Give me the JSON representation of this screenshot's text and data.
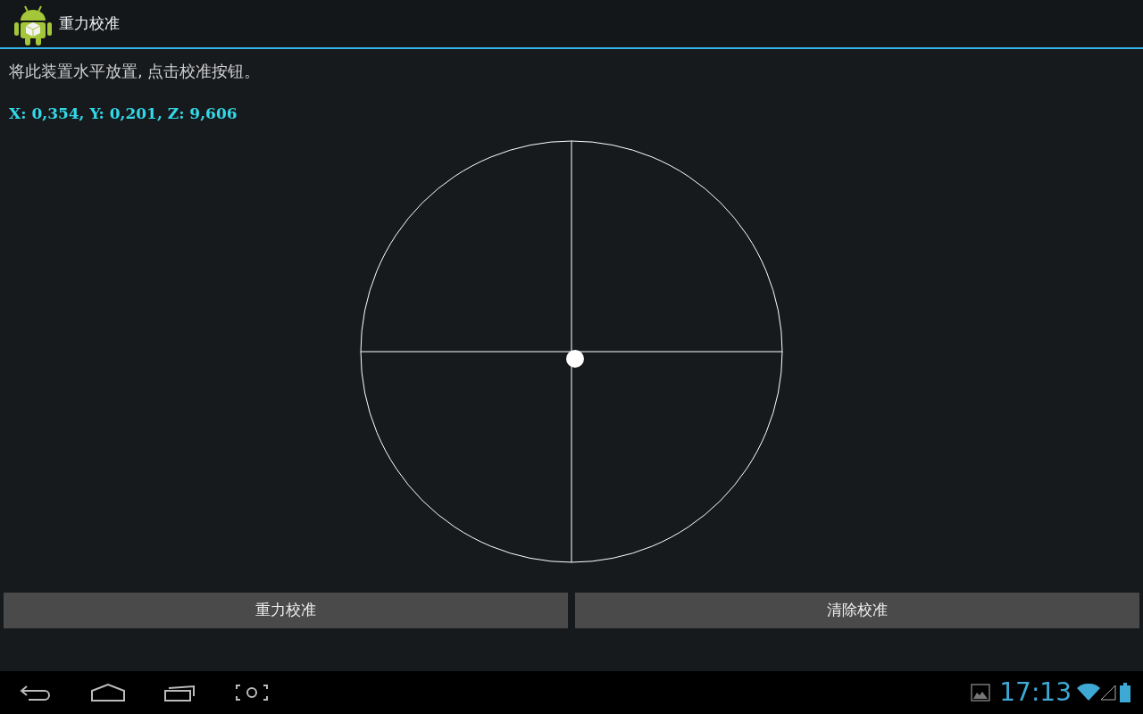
{
  "action_bar": {
    "title": "重力校准"
  },
  "instruction": "将此装置水平放置, 点击校准按钮。",
  "readout": "X: 0,354, Y: 0,201, Z: 9,606",
  "buttons": [
    {
      "label": "重力校准"
    },
    {
      "label": "清除校准"
    }
  ],
  "status_bar": {
    "time": "17:13"
  }
}
